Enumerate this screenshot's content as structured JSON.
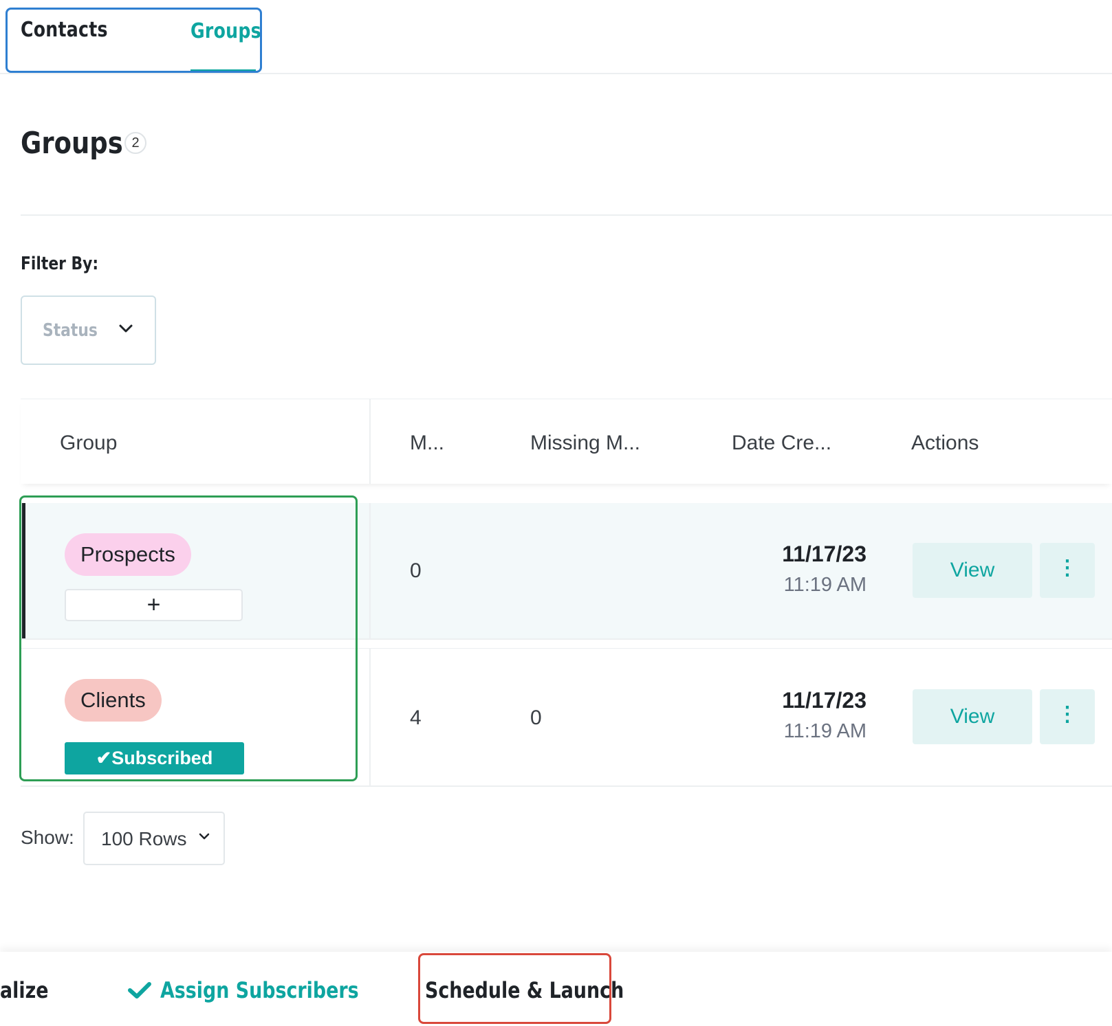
{
  "tabs": [
    {
      "label": "Contacts",
      "active": false
    },
    {
      "label": "Groups",
      "active": true
    }
  ],
  "page": {
    "title": "Groups",
    "count": "2"
  },
  "filter": {
    "label": "Filter By:",
    "status_placeholder": "Status"
  },
  "table": {
    "headers": [
      "Group",
      "M...",
      "Missing M...",
      "Date Cre...",
      "Actions"
    ],
    "rows": [
      {
        "group": "Prospects",
        "group_color": "#fbd0ec",
        "add_label": "+",
        "members": "0",
        "missing": "",
        "date": "11/17/23",
        "time": "11:19 AM",
        "view_label": "View",
        "selected": true
      },
      {
        "group": "Clients",
        "group_color": "#f7c6c3",
        "badge": "Subscribed",
        "members": "4",
        "missing": "0",
        "date": "11/17/23",
        "time": "11:19 AM",
        "view_label": "View",
        "selected": false
      }
    ]
  },
  "pagination": {
    "show_label": "Show:",
    "rows_value": "100 Rows"
  },
  "stepper": {
    "prev_partial": "alize",
    "assign_label": "Assign Subscribers",
    "schedule_label": "Schedule & Launch"
  },
  "colors": {
    "accent": "#0ea5a0",
    "tabs_highlight": "#2f7fd1",
    "group_highlight": "#2e9e55",
    "schedule_highlight": "#d9483b"
  },
  "icons": [
    "chevron-down-icon",
    "plus-icon",
    "check-icon",
    "more-vertical-icon"
  ]
}
